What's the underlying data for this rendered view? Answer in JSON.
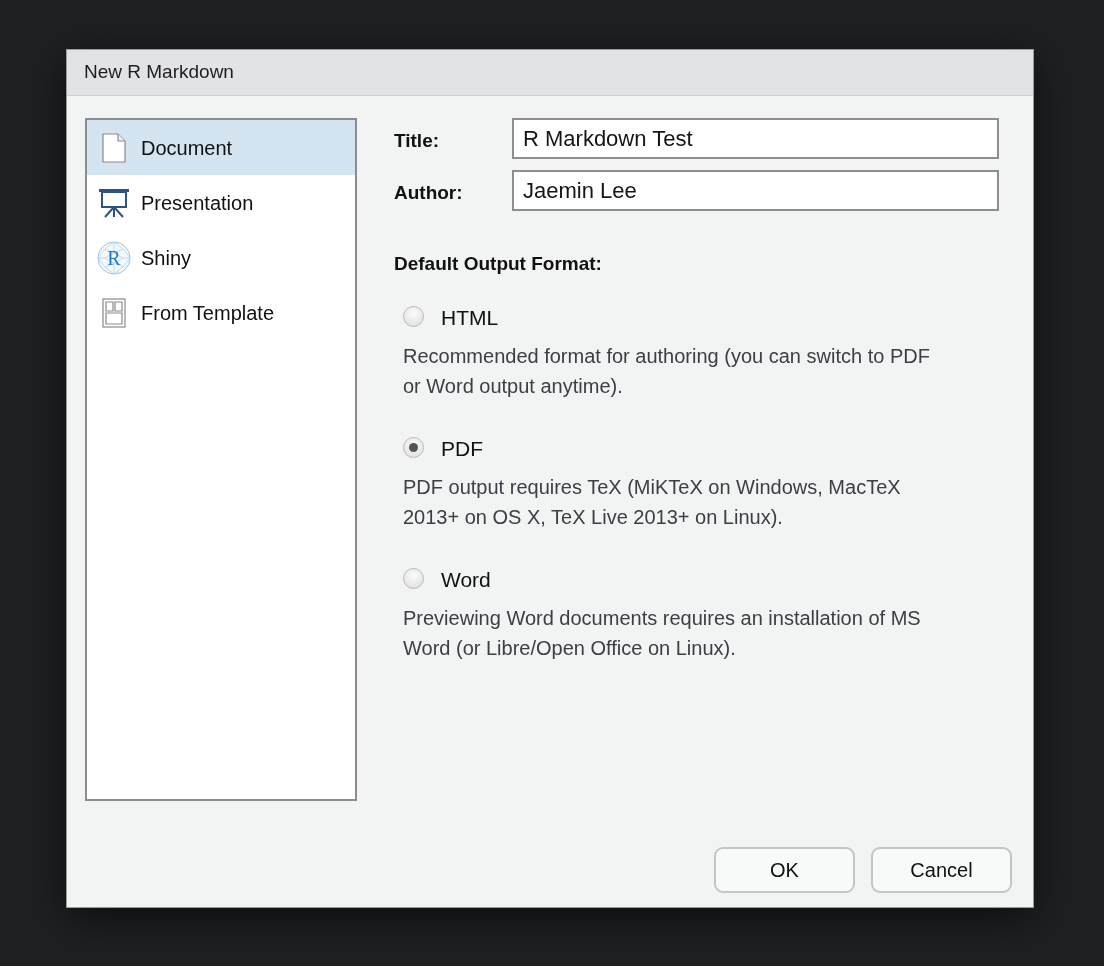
{
  "window": {
    "title": "New R Markdown"
  },
  "sidebar": {
    "items": [
      {
        "kind": "document",
        "label": "Document",
        "selected": true
      },
      {
        "kind": "presentation",
        "label": "Presentation",
        "selected": false
      },
      {
        "kind": "shiny",
        "label": "Shiny",
        "selected": false,
        "logo_letter": "R"
      },
      {
        "kind": "template",
        "label": "From Template",
        "selected": false
      }
    ]
  },
  "fields": [
    {
      "label": "Title:",
      "value": "R Markdown Test"
    },
    {
      "label": "Author:",
      "value": "Jaemin Lee"
    }
  ],
  "output_format": {
    "heading": "Default Output Format:",
    "options": [
      {
        "label": "HTML",
        "description": "Recommended format for authoring (you can switch to PDF or Word output anytime).",
        "selected": false
      },
      {
        "label": "PDF",
        "description": "PDF output requires TeX (MiKTeX on Windows, MacTeX 2013+ on OS X, TeX Live 2013+ on Linux).",
        "selected": true
      },
      {
        "label": "Word",
        "description": "Previewing Word documents requires an installation of MS Word (or Libre/Open Office on Linux).",
        "selected": false
      }
    ]
  },
  "buttons": [
    "OK",
    "Cancel"
  ]
}
